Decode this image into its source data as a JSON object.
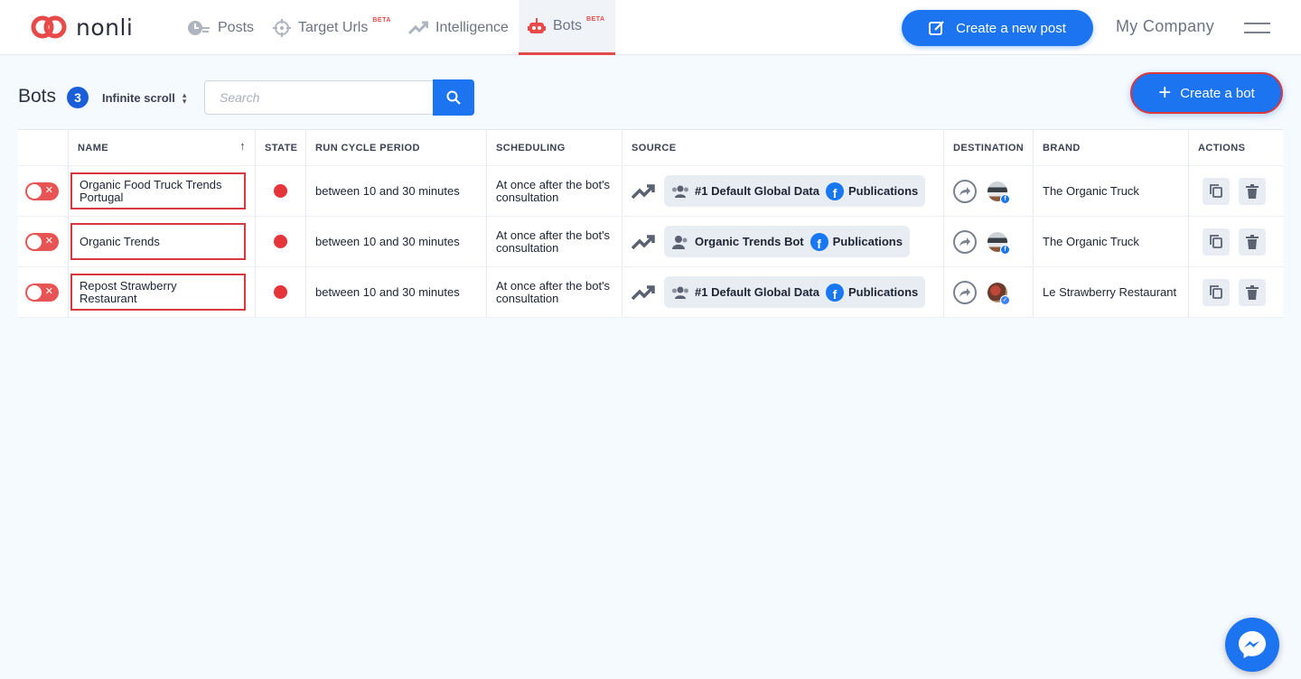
{
  "app": {
    "logo_text": "nonli",
    "company": "My Company"
  },
  "nav": {
    "items": [
      {
        "label": "Posts",
        "icon": "clock-icon",
        "beta": ""
      },
      {
        "label": "Target Urls",
        "icon": "crosshair-icon",
        "beta": "BETA"
      },
      {
        "label": "Intelligence",
        "icon": "trend-icon",
        "beta": ""
      },
      {
        "label": "Bots",
        "icon": "robot-icon",
        "beta": "BETA"
      }
    ],
    "active": "Bots",
    "new_post_label": "Create a new post"
  },
  "page": {
    "title": "Bots",
    "count": "3",
    "scroll_mode": "Infinite scroll",
    "search_placeholder": "Search",
    "create_label": "Create a bot"
  },
  "table": {
    "columns": [
      "NAME",
      "STATE",
      "RUN CYCLE PERIOD",
      "SCHEDULING",
      "SOURCE",
      "DESTINATION",
      "BRAND",
      "ACTIONS"
    ],
    "rows": [
      {
        "name": "Organic Food Truck Trends Portugal",
        "run_cycle": "between 10 and 30 minutes",
        "scheduling": "At once after the bot's consultation",
        "source_group": "#1 Default Global Data",
        "source_pub": "Publications",
        "brand": "The Organic Truck"
      },
      {
        "name": "Organic Trends",
        "run_cycle": "between 10 and 30 minutes",
        "scheduling": "At once after the bot's consultation",
        "source_group": "Organic Trends Bot",
        "source_pub": "Publications",
        "brand": "The Organic Truck"
      },
      {
        "name": "Repost Strawberry Restaurant",
        "run_cycle": "between 10 and 30 minutes",
        "scheduling": "At once after the bot's consultation",
        "source_group": "#1 Default Global Data",
        "source_pub": "Publications",
        "brand": "Le Strawberry Restaurant"
      }
    ]
  },
  "colors": {
    "accent": "#1c74f0",
    "danger": "#e5343a",
    "highlight_border": "#d9383f"
  }
}
